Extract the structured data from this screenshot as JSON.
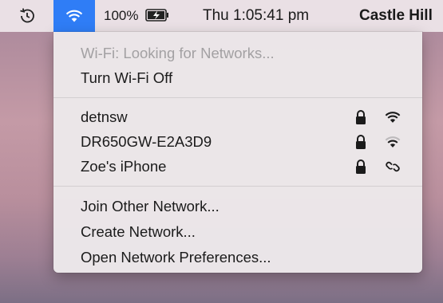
{
  "menubar": {
    "battery_percent": "100%",
    "clock": "Thu 1:05:41 pm",
    "user": "Castle Hill",
    "icons": [
      "time-machine-icon",
      "wifi-icon",
      "battery-charging-icon"
    ]
  },
  "wifi_menu": {
    "status": "Wi-Fi: Looking for Networks...",
    "toggle_label": "Turn Wi-Fi Off",
    "networks": [
      {
        "name": "detnsw",
        "secured": true,
        "signal_icon": "wifi-signal-icon"
      },
      {
        "name": "DR650GW-E2A3D9",
        "secured": true,
        "signal_icon": "wifi-signal-icon"
      },
      {
        "name": "Zoe's iPhone",
        "secured": true,
        "signal_icon": "personal-hotspot-icon"
      }
    ],
    "join_other": "Join Other Network...",
    "create_network": "Create Network...",
    "open_prefs": "Open Network Preferences..."
  },
  "colors": {
    "menubar_highlight": "#2f7df6"
  }
}
